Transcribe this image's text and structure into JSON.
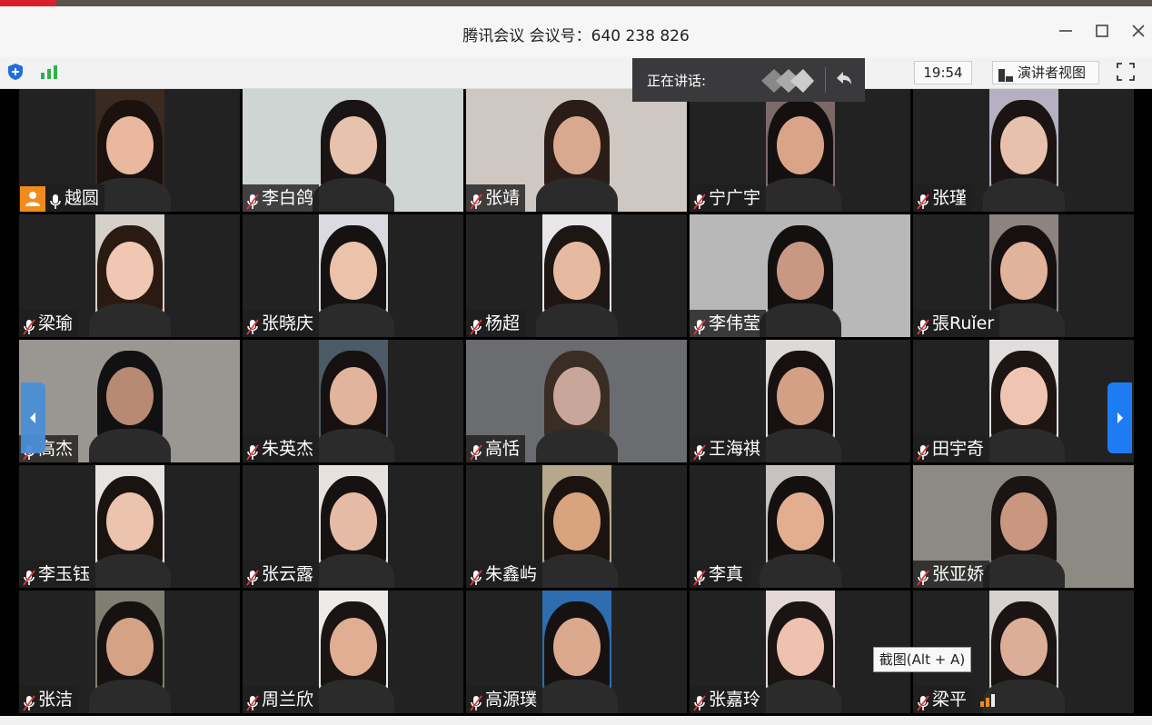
{
  "window": {
    "title": "腾讯会议 会议号：640 238 826",
    "minimize_icon": "minimize-icon",
    "maximize_icon": "maximize-icon",
    "close_icon": "close-icon"
  },
  "toolbar": {
    "time": "19:54",
    "presenter_view": "演讲者视图",
    "icons": [
      "shield-icon",
      "signal-icon",
      "presenter-view-icon",
      "fullscreen-icon"
    ]
  },
  "speaking": {
    "label": "正在讲话:"
  },
  "tooltip": "截图(Alt + A)",
  "colors": {
    "accent": "#1e7cf2",
    "host": "#f08c1e",
    "tile_bg": "#222222",
    "brand_red": "#d8212a"
  },
  "participants": [
    {
      "name": "越圆"
    },
    {
      "name": "李白鸽"
    },
    {
      "name": "张靖"
    },
    {
      "name": "宁广宇"
    },
    {
      "name": "张瑾"
    },
    {
      "name": "梁瑜"
    },
    {
      "name": "张晓庆"
    },
    {
      "name": "杨超"
    },
    {
      "name": "李伟莹"
    },
    {
      "name": "張Ruǐer"
    },
    {
      "name": "高杰"
    },
    {
      "name": "朱英杰"
    },
    {
      "name": "高恬"
    },
    {
      "name": "王海祺"
    },
    {
      "name": "田宇奇"
    },
    {
      "name": "李玉钰"
    },
    {
      "name": "张云露"
    },
    {
      "name": "朱鑫屿"
    },
    {
      "name": "李真"
    },
    {
      "name": "张亚娇"
    },
    {
      "name": "张洁"
    },
    {
      "name": "周兰欣"
    },
    {
      "name": "高源璞"
    },
    {
      "name": "张嘉玲"
    },
    {
      "name": "梁平"
    }
  ]
}
